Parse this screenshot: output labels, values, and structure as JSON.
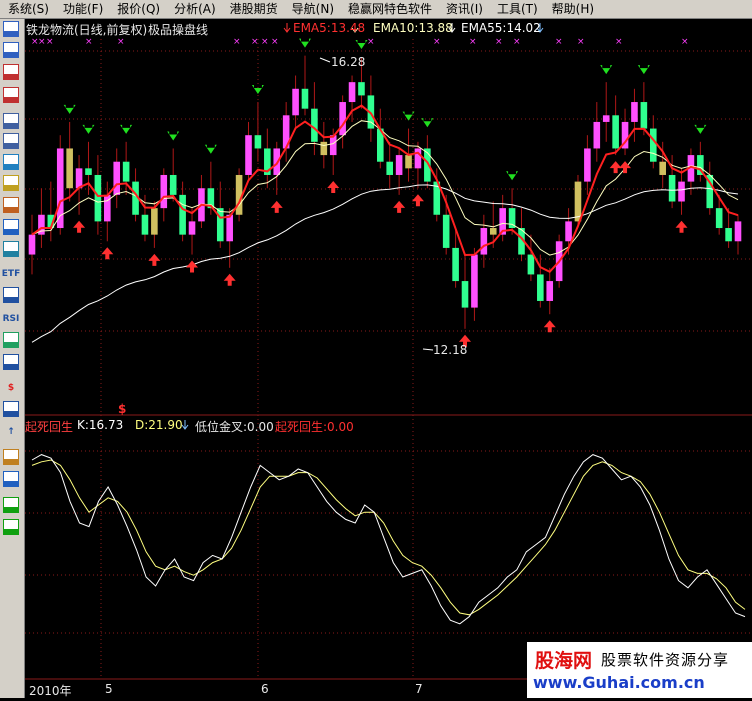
{
  "menu": [
    {
      "label": "系统(S)",
      "name": "menu-system"
    },
    {
      "label": "功能(F)",
      "name": "menu-function"
    },
    {
      "label": "报价(Q)",
      "name": "menu-quote"
    },
    {
      "label": "分析(A)",
      "name": "menu-analysis"
    },
    {
      "label": "港股期货",
      "name": "menu-hk-futures"
    },
    {
      "label": "导航(N)",
      "name": "menu-navigation"
    },
    {
      "label": "稳赢网特色软件",
      "name": "menu-wenying-software"
    },
    {
      "label": "资讯(I)",
      "name": "menu-news"
    },
    {
      "label": "工具(T)",
      "name": "menu-tools"
    },
    {
      "label": "帮助(H)",
      "name": "menu-help"
    }
  ],
  "toolbar_icons": [
    "market-icon",
    "quote-list-icon",
    "line-chart-icon",
    "kline-icon",
    "window-icon",
    "report-icon",
    "f10-icon",
    "message-icon",
    "users-icon",
    "tech-icon",
    "browser-icon",
    "etf-icon",
    "wave-icon",
    "rsi-icon",
    "table-icon",
    "calc-icon",
    "money-icon",
    "zoom-in-icon",
    "arrow-up-icon",
    "pen-icon",
    "move-icon",
    "up-green-icon",
    "down-green-icon"
  ],
  "toolbar_text": {
    "etf-icon": "ETF",
    "rsi-icon": "RSI",
    "money-icon": "$",
    "arrow-up-icon": "↑"
  },
  "colors": {
    "up": "#ff50ff",
    "down": "#30ff90",
    "neutral": "#d0c060",
    "ema5": "#ff2020",
    "ema10": "#ffffc0",
    "ema55": "#ffffff",
    "kline_k": "#ffffff",
    "kline_d": "#ffff80",
    "grid": "#8a1a1a",
    "arrow_buy": "#ff3030",
    "arrow_sell": "#20e020",
    "magenta_x": "#ff40ff"
  },
  "main_panel": {
    "title": "铁龙物流(日线,前复权)",
    "indicator_name": "极品操盘线",
    "ema5": "EMA5:13.48",
    "ema10": "EMA10:13.88",
    "ema55": "EMA55:14.02",
    "high_label": "16.28",
    "low_label": "12.18"
  },
  "sub_panel": {
    "name": "起死回生",
    "k": "K:16.73",
    "d": "D:21.90",
    "golden_cross": "低位金叉:0.00",
    "revive": "起死回生:0.00",
    "dollar_marker": "$"
  },
  "x_axis": {
    "labels": [
      "2010年",
      "5",
      "6",
      "7"
    ]
  },
  "watermark": {
    "brand": "股海网",
    "slogan": "股票软件资源分享",
    "url": "www.Guhai.com.cn"
  },
  "chart_data": {
    "type": "candlestick",
    "ohlc": [
      [
        13.3,
        13.9,
        13.0,
        13.6
      ],
      [
        13.6,
        14.3,
        13.4,
        13.9
      ],
      [
        13.9,
        14.4,
        13.5,
        13.7
      ],
      [
        13.7,
        15.1,
        13.6,
        14.9
      ],
      [
        14.9,
        15.3,
        14.1,
        14.3
      ],
      [
        14.3,
        14.8,
        13.9,
        14.6
      ],
      [
        14.6,
        15.0,
        14.2,
        14.5
      ],
      [
        14.5,
        14.8,
        13.6,
        13.8
      ],
      [
        13.8,
        14.4,
        13.5,
        14.2
      ],
      [
        14.2,
        14.9,
        14.0,
        14.7
      ],
      [
        14.7,
        15.0,
        14.2,
        14.4
      ],
      [
        14.4,
        14.6,
        13.8,
        13.9
      ],
      [
        13.9,
        14.2,
        13.5,
        13.6
      ],
      [
        13.6,
        14.1,
        13.4,
        14.0
      ],
      [
        14.0,
        14.6,
        13.8,
        14.5
      ],
      [
        14.5,
        14.9,
        14.1,
        14.2
      ],
      [
        14.2,
        14.4,
        13.5,
        13.6
      ],
      [
        13.6,
        14.0,
        13.3,
        13.8
      ],
      [
        13.8,
        14.5,
        13.7,
        14.3
      ],
      [
        14.3,
        14.7,
        13.9,
        14.0
      ],
      [
        14.0,
        14.4,
        13.4,
        13.5
      ],
      [
        13.5,
        14.0,
        13.1,
        13.9
      ],
      [
        13.9,
        14.6,
        13.8,
        14.5
      ],
      [
        14.5,
        15.3,
        14.4,
        15.1
      ],
      [
        15.1,
        15.6,
        14.7,
        14.9
      ],
      [
        14.9,
        15.2,
        14.3,
        14.5
      ],
      [
        14.5,
        15.0,
        14.2,
        14.9
      ],
      [
        14.9,
        15.6,
        14.7,
        15.4
      ],
      [
        15.4,
        16.0,
        15.2,
        15.8
      ],
      [
        15.8,
        16.3,
        15.4,
        15.5
      ],
      [
        15.5,
        15.9,
        14.8,
        15.0
      ],
      [
        15.0,
        15.3,
        14.6,
        14.8
      ],
      [
        14.8,
        15.2,
        14.5,
        15.1
      ],
      [
        15.1,
        15.7,
        14.9,
        15.6
      ],
      [
        15.6,
        16.0,
        15.3,
        15.9
      ],
      [
        15.9,
        16.28,
        15.5,
        15.7
      ],
      [
        15.7,
        16.0,
        15.0,
        15.2
      ],
      [
        15.2,
        15.5,
        14.6,
        14.7
      ],
      [
        14.7,
        15.0,
        14.3,
        14.5
      ],
      [
        14.5,
        14.9,
        14.2,
        14.8
      ],
      [
        14.8,
        15.2,
        14.4,
        14.6
      ],
      [
        14.6,
        15.0,
        14.3,
        14.9
      ],
      [
        14.9,
        15.1,
        14.3,
        14.4
      ],
      [
        14.4,
        14.6,
        13.8,
        13.9
      ],
      [
        13.9,
        14.2,
        13.3,
        13.4
      ],
      [
        13.4,
        13.7,
        12.8,
        12.9
      ],
      [
        12.9,
        13.3,
        12.18,
        12.5
      ],
      [
        12.5,
        13.4,
        12.3,
        13.3
      ],
      [
        13.3,
        13.9,
        13.1,
        13.7
      ],
      [
        13.7,
        14.1,
        13.4,
        13.6
      ],
      [
        13.6,
        14.2,
        13.5,
        14.0
      ],
      [
        14.0,
        14.3,
        13.6,
        13.7
      ],
      [
        13.7,
        14.0,
        13.2,
        13.3
      ],
      [
        13.3,
        13.6,
        12.9,
        13.0
      ],
      [
        13.0,
        13.3,
        12.5,
        12.6
      ],
      [
        12.6,
        13.1,
        12.4,
        12.9
      ],
      [
        12.9,
        13.6,
        12.8,
        13.5
      ],
      [
        13.5,
        14.0,
        13.3,
        13.8
      ],
      [
        13.8,
        14.5,
        13.7,
        14.4
      ],
      [
        14.4,
        15.1,
        14.2,
        14.9
      ],
      [
        14.9,
        15.6,
        14.7,
        15.3
      ],
      [
        15.3,
        15.9,
        15.0,
        15.4
      ],
      [
        15.4,
        15.7,
        14.8,
        14.9
      ],
      [
        14.9,
        15.5,
        14.8,
        15.3
      ],
      [
        15.3,
        15.8,
        15.0,
        15.6
      ],
      [
        15.6,
        15.9,
        15.1,
        15.2
      ],
      [
        15.2,
        15.4,
        14.6,
        14.7
      ],
      [
        14.7,
        15.0,
        14.3,
        14.5
      ],
      [
        14.5,
        14.8,
        14.0,
        14.1
      ],
      [
        14.1,
        14.6,
        13.9,
        14.4
      ],
      [
        14.4,
        14.9,
        14.2,
        14.8
      ],
      [
        14.8,
        15.0,
        14.4,
        14.5
      ],
      [
        14.5,
        14.7,
        13.9,
        14.0
      ],
      [
        14.0,
        14.2,
        13.6,
        13.7
      ],
      [
        13.7,
        14.0,
        13.4,
        13.5
      ],
      [
        13.5,
        13.9,
        13.3,
        13.8
      ]
    ],
    "kd_k": [
      95,
      98,
      96,
      88,
      72,
      60,
      58,
      72,
      80,
      70,
      58,
      45,
      30,
      25,
      34,
      40,
      30,
      28,
      38,
      42,
      40,
      52,
      66,
      80,
      92,
      88,
      84,
      86,
      90,
      88,
      80,
      72,
      66,
      62,
      60,
      70,
      66,
      52,
      38,
      30,
      32,
      34,
      25,
      14,
      6,
      4,
      8,
      16,
      20,
      24,
      30,
      34,
      44,
      48,
      52,
      64,
      76,
      86,
      94,
      98,
      96,
      90,
      84,
      86,
      80,
      70,
      56,
      40,
      28,
      24,
      30,
      34,
      26,
      18,
      10,
      8
    ],
    "kd_d": [
      92,
      94,
      95,
      92,
      84,
      74,
      66,
      70,
      74,
      72,
      66,
      56,
      44,
      36,
      34,
      36,
      33,
      31,
      34,
      38,
      40,
      46,
      56,
      68,
      80,
      86,
      86,
      86,
      88,
      88,
      85,
      79,
      73,
      68,
      64,
      66,
      66,
      60,
      50,
      42,
      38,
      36,
      31,
      24,
      16,
      10,
      9,
      12,
      16,
      20,
      25,
      30,
      36,
      42,
      48,
      56,
      66,
      76,
      86,
      92,
      94,
      92,
      88,
      86,
      83,
      76,
      66,
      54,
      42,
      34,
      32,
      32,
      29,
      24,
      16,
      12
    ],
    "ema5_label": 13.48,
    "ema10_label": 13.88,
    "ema55_label": 14.02,
    "high": 16.28,
    "low": 12.18
  }
}
